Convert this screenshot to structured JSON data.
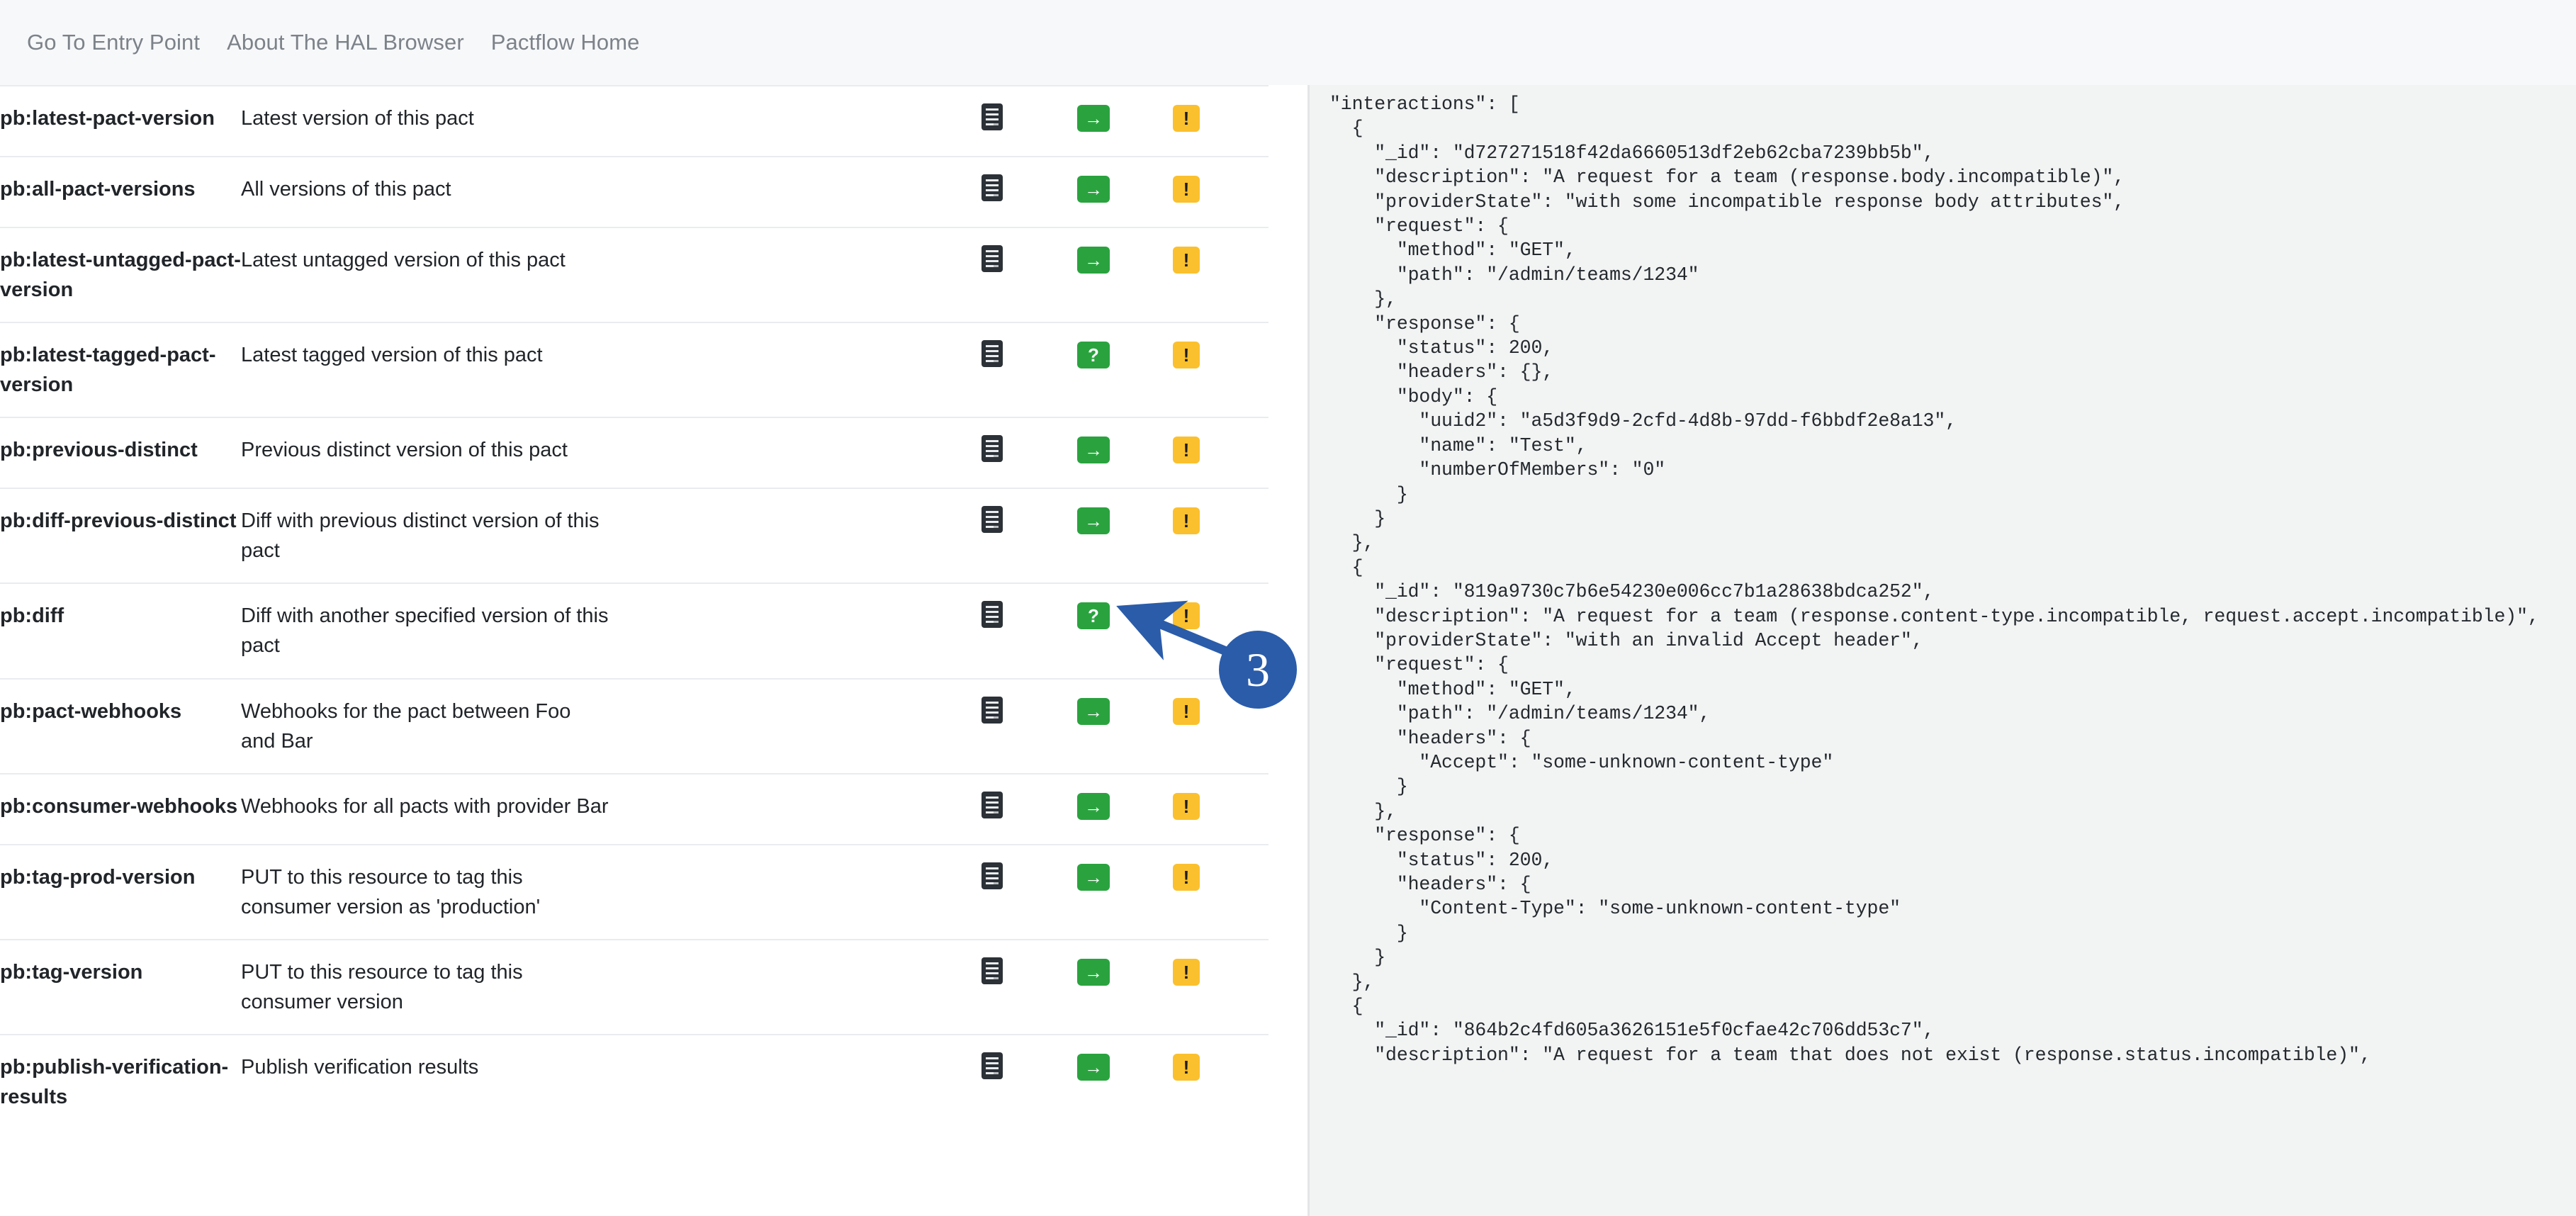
{
  "navbar": {
    "links": [
      {
        "label": "Go To Entry Point"
      },
      {
        "label": "About The HAL Browser"
      },
      {
        "label": "Pactflow Home"
      }
    ]
  },
  "colors": {
    "navbar_bg": "#f7f8fa",
    "nav_link": "#7c8289",
    "badge_green": "#2aa33f",
    "badge_yellow": "#fbc02d",
    "doc_icon": "#2b3137",
    "annotation_blue": "#2a5caa",
    "json_panel_bg": "#f2f3f3",
    "row_border": "#e9ecef"
  },
  "link_table": {
    "rows": [
      {
        "rel": "pb:latest-pact-version",
        "title": "Latest version of this pact",
        "doc_icon": "document-icon",
        "action_icon": "arrow-right-icon",
        "action_label": "→",
        "warn_label": "!"
      },
      {
        "rel": "pb:all-pact-versions",
        "title": "All versions of this pact",
        "doc_icon": "document-icon",
        "action_icon": "arrow-right-icon",
        "action_label": "→",
        "warn_label": "!"
      },
      {
        "rel": "pb:latest-untagged-pact-version",
        "title": "Latest untagged version of this pact",
        "doc_icon": "document-icon",
        "action_icon": "arrow-right-icon",
        "action_label": "→",
        "warn_label": "!"
      },
      {
        "rel": "pb:latest-tagged-pact-version",
        "title": "Latest tagged version of this pact",
        "doc_icon": "document-icon",
        "action_icon": "question-mark-icon",
        "action_label": "?",
        "warn_label": "!"
      },
      {
        "rel": "pb:previous-distinct",
        "title": "Previous distinct version of this pact",
        "doc_icon": "document-icon",
        "action_icon": "arrow-right-icon",
        "action_label": "→",
        "warn_label": "!"
      },
      {
        "rel": "pb:diff-previous-distinct",
        "title": "Diff with previous distinct version of this pact",
        "doc_icon": "document-icon",
        "action_icon": "arrow-right-icon",
        "action_label": "→",
        "warn_label": "!"
      },
      {
        "rel": "pb:diff",
        "title": "Diff with another specified version of this pact",
        "doc_icon": "document-icon",
        "action_icon": "question-mark-icon",
        "action_label": "?",
        "warn_label": "!"
      },
      {
        "rel": "pb:pact-webhooks",
        "title": "Webhooks for the pact between Foo and Bar",
        "doc_icon": "document-icon",
        "action_icon": "arrow-right-icon",
        "action_label": "→",
        "warn_label": "!"
      },
      {
        "rel": "pb:consumer-webhooks",
        "title": "Webhooks for all pacts with provider Bar",
        "doc_icon": "document-icon",
        "action_icon": "arrow-right-icon",
        "action_label": "→",
        "warn_label": "!"
      },
      {
        "rel": "pb:tag-prod-version",
        "title": "PUT to this resource to tag this consumer version as 'production'",
        "doc_icon": "document-icon",
        "action_icon": "arrow-right-icon",
        "action_label": "→",
        "warn_label": "!"
      },
      {
        "rel": "pb:tag-version",
        "title": "PUT to this resource to tag this consumer version",
        "doc_icon": "document-icon",
        "action_icon": "arrow-right-icon",
        "action_label": "→",
        "warn_label": "!"
      },
      {
        "rel": "pb:publish-verification-results",
        "title": "Publish verification results",
        "doc_icon": "document-icon",
        "action_icon": "arrow-right-icon",
        "action_label": "→",
        "warn_label": "!"
      }
    ]
  },
  "json_panel": {
    "content": "\"interactions\": [\n  {\n    \"_id\": \"d727271518f42da6660513df2eb62cba7239bb5b\",\n    \"description\": \"A request for a team (response.body.incompatible)\",\n    \"providerState\": \"with some incompatible response body attributes\",\n    \"request\": {\n      \"method\": \"GET\",\n      \"path\": \"/admin/teams/1234\"\n    },\n    \"response\": {\n      \"status\": 200,\n      \"headers\": {},\n      \"body\": {\n        \"uuid2\": \"a5d3f9d9-2cfd-4d8b-97dd-f6bbdf2e8a13\",\n        \"name\": \"Test\",\n        \"numberOfMembers\": \"0\"\n      }\n    }\n  },\n  {\n    \"_id\": \"819a9730c7b6e54230e006cc7b1a28638bdca252\",\n    \"description\": \"A request for a team (response.content-type.incompatible, request.accept.incompatible)\",\n    \"providerState\": \"with an invalid Accept header\",\n    \"request\": {\n      \"method\": \"GET\",\n      \"path\": \"/admin/teams/1234\",\n      \"headers\": {\n        \"Accept\": \"some-unknown-content-type\"\n      }\n    },\n    \"response\": {\n      \"status\": 200,\n      \"headers\": {\n        \"Content-Type\": \"some-unknown-content-type\"\n      }\n    }\n  },\n  {\n    \"_id\": \"864b2c4fd605a3626151e5f0cfae42c706dd53c7\",\n    \"description\": \"A request for a team that does not exist (response.status.incompatible)\","
  },
  "annotation": {
    "step_number": "3"
  }
}
